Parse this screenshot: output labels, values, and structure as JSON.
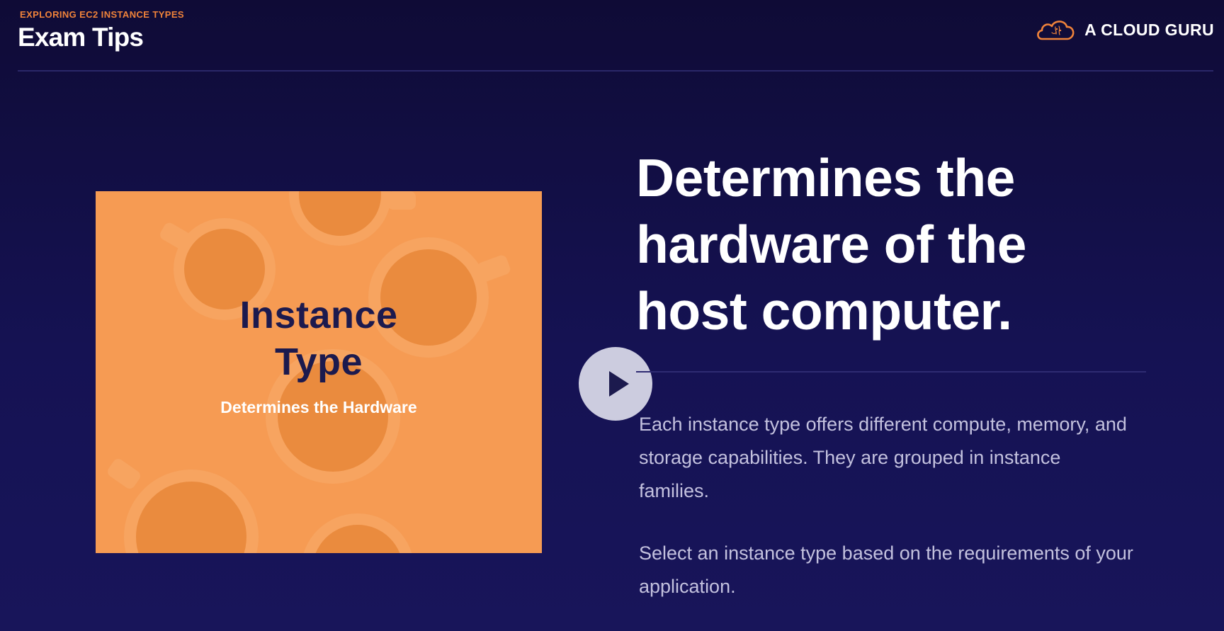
{
  "header": {
    "eyebrow": "EXPLORING EC2 INSTANCE TYPES",
    "title": "Exam Tips",
    "brand": {
      "name": "A CLOUD GURU",
      "logo_icon": "cloud-guru-logo-icon",
      "logo_color": "#f0833a"
    }
  },
  "thumbnail": {
    "title": "Instance\nType",
    "subtitle": "Determines the Hardware",
    "background_color": "#f69b53",
    "title_color": "#1c1a4e"
  },
  "video": {
    "play_icon": "play-icon"
  },
  "main": {
    "headline": "Determines the hardware of the host computer.",
    "paragraphs": [
      "Each instance type offers different compute, memory, and storage capabilities. They are grouped in instance families.",
      "Select an instance type based on the requirements of your application."
    ]
  },
  "colors": {
    "background": "#151253",
    "accent": "#f0833a",
    "text_muted": "#c3c1de"
  }
}
